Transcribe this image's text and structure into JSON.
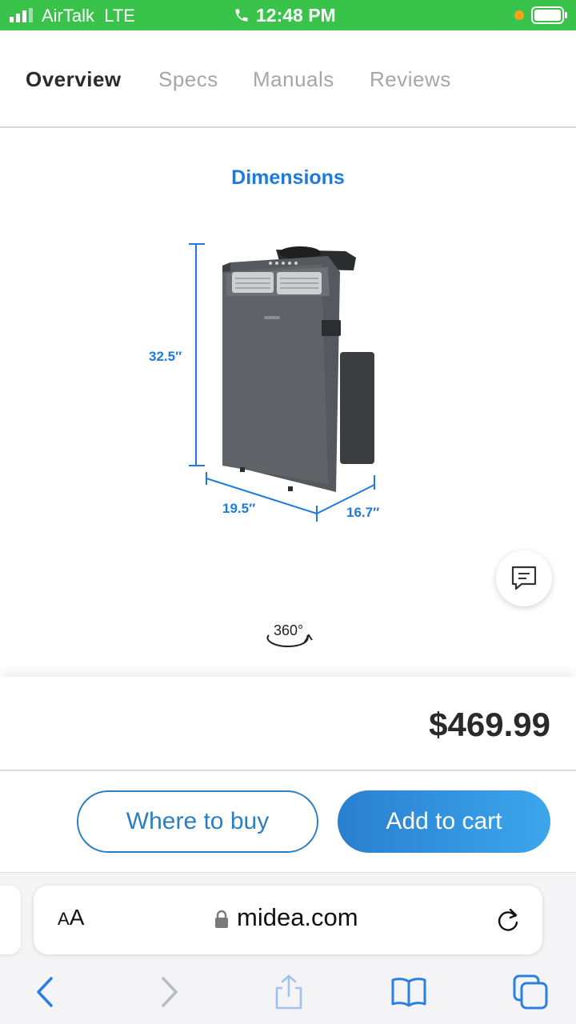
{
  "colors": {
    "status_green": "#39c34a",
    "dimension_blue": "#1f7ae0",
    "button_blue": "#2c7ec2",
    "ios_blue": "#2a7fe3",
    "battery_dot": "#f7a11a"
  },
  "status_bar": {
    "carrier": "AirTalk",
    "network": "LTE",
    "time": "12:48 PM"
  },
  "tabs": [
    {
      "label": "Overview",
      "active": true
    },
    {
      "label": "Specs",
      "active": false
    },
    {
      "label": "Manuals",
      "active": false
    },
    {
      "label": "Reviews",
      "active": false
    }
  ],
  "product": {
    "section_title": "Dimensions",
    "height": "32.5″",
    "width": "19.5″",
    "depth": "16.7″",
    "rotate_label": "360°"
  },
  "price": "$469.99",
  "buttons": {
    "where_to_buy": "Where to buy",
    "add_to_cart": "Add to cart"
  },
  "browser": {
    "text_size_label_small": "A",
    "text_size_label_large": "A",
    "url": "midea.com"
  },
  "icons": [
    "signal-icon",
    "phone-icon",
    "battery-icon",
    "chat-icon",
    "rotate-360-icon",
    "lock-icon",
    "reload-icon",
    "back-icon",
    "forward-icon",
    "share-icon",
    "bookmarks-icon",
    "tabs-icon"
  ]
}
